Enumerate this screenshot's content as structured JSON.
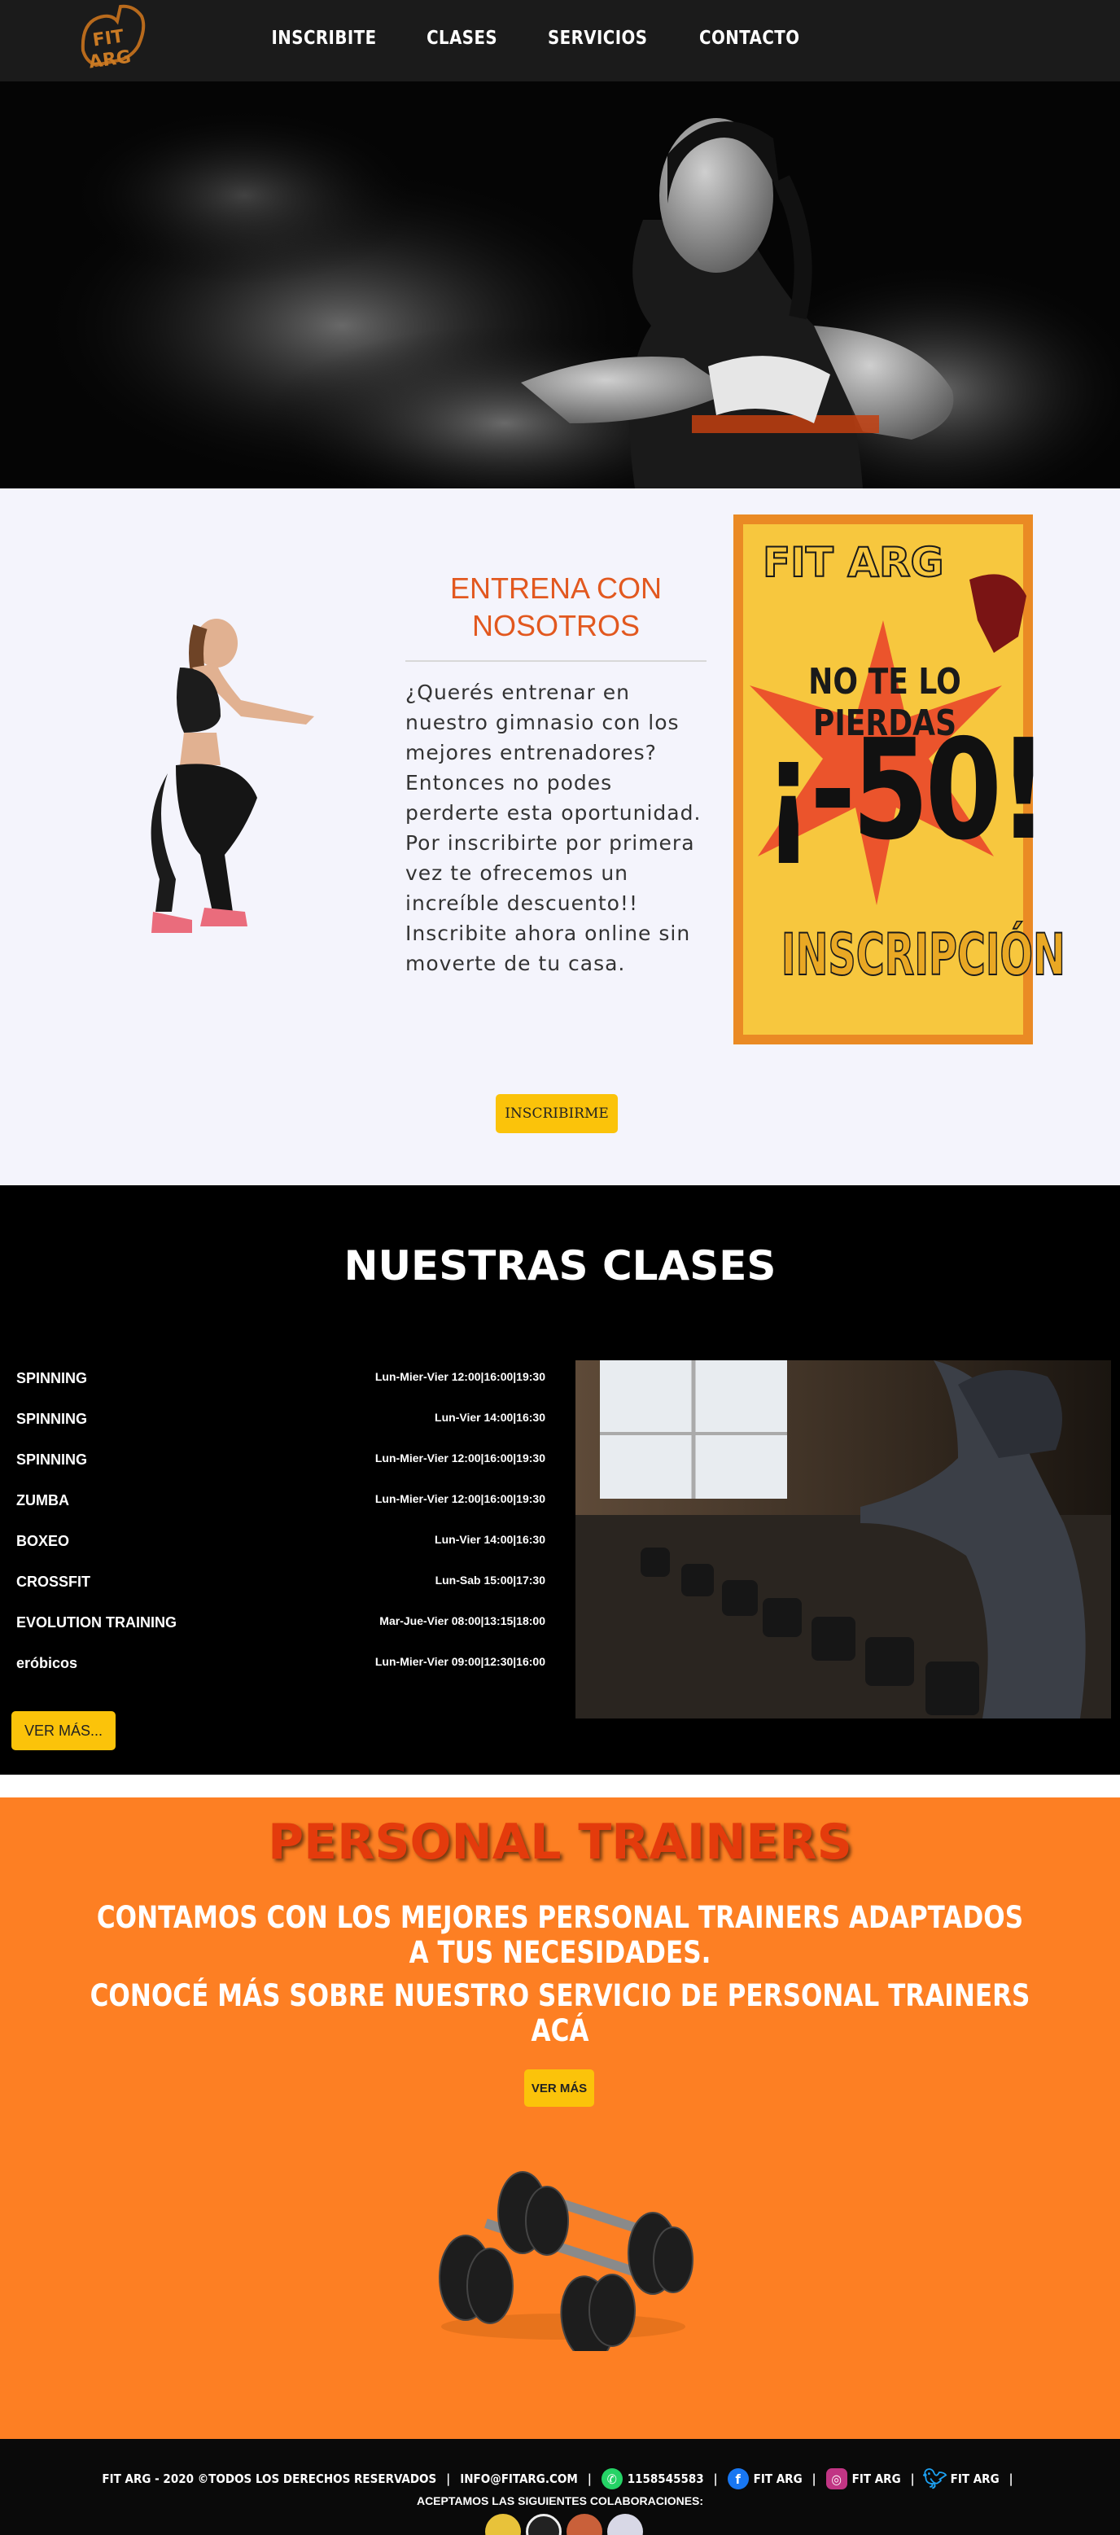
{
  "nav": {
    "logo_text": "FIT ARG",
    "items": [
      {
        "label": "INSCRIBITE"
      },
      {
        "label": "CLASES"
      },
      {
        "label": "SERVICIOS"
      },
      {
        "label": "CONTACTO"
      }
    ]
  },
  "promo": {
    "title": "ENTRENA CON NOSOTROS",
    "text": "¿Querés entrenar en nuestro gimnasio con los mejores entrenadores? Entonces no podes perderte esta oportunidad. Por inscribirte por primera vez te ofrecemos un increíble descuento!! Inscribite ahora online sin moverte de tu casa.",
    "poster": {
      "brand": "FIT ARG",
      "headline": "NO TE LO PIERDAS",
      "discount": "¡-50!",
      "footer": "INSCRIPCIÓN"
    },
    "button_label": "INSCRIBIRME"
  },
  "classes": {
    "title": "NUESTRAS CLASES",
    "rows": [
      {
        "name": "SPINNING",
        "schedule": "Lun-Mier-Vier 12:00|16:00|19:30"
      },
      {
        "name": "SPINNING",
        "schedule": "Lun-Vier 14:00|16:30"
      },
      {
        "name": "SPINNING",
        "schedule": "Lun-Mier-Vier 12:00|16:00|19:30"
      },
      {
        "name": "ZUMBA",
        "schedule": "Lun-Mier-Vier 12:00|16:00|19:30"
      },
      {
        "name": "BOXEO",
        "schedule": "Lun-Vier 14:00|16:30"
      },
      {
        "name": "CROSSFIT",
        "schedule": "Lun-Sab 15:00|17:30"
      },
      {
        "name": "EVOLUTION TRAINING",
        "schedule": "Mar-Jue-Vier 08:00|13:15|18:00"
      },
      {
        "name": "eróbicos",
        "schedule": "Lun-Mier-Vier 09:00|12:30|16:00"
      }
    ],
    "button_label": "VER MÁS..."
  },
  "trainers": {
    "title": "PERSONAL TRAINERS",
    "line1": "CONTAMOS CON LOS MEJORES PERSONAL TRAINERS ADAPTADOS A TUS NECESIDADES.",
    "line2": "CONOCÉ MÁS SOBRE NUESTRO SERVICIO DE PERSONAL TRAINERS ACÁ",
    "button_label": "VER MÁS"
  },
  "footer": {
    "copyright": "FIT ARG - 2020 ©TODOS LOS DERECHOS RESERVADOS",
    "email": "INFO@FITARG.COM",
    "phone": "1158545583",
    "facebook": "FIT ARG",
    "instagram": "FIT ARG",
    "twitter": "FIT ARG",
    "accept_text": "ACEPTAMOS LAS SIGUIENTES COLABORACIONES:",
    "separator": "|"
  },
  "colors": {
    "accent_orange": "#e2581f",
    "button_yellow": "#fbc30a",
    "trainers_bg": "#fd7f23",
    "nav_bg": "#1b1b1b"
  }
}
